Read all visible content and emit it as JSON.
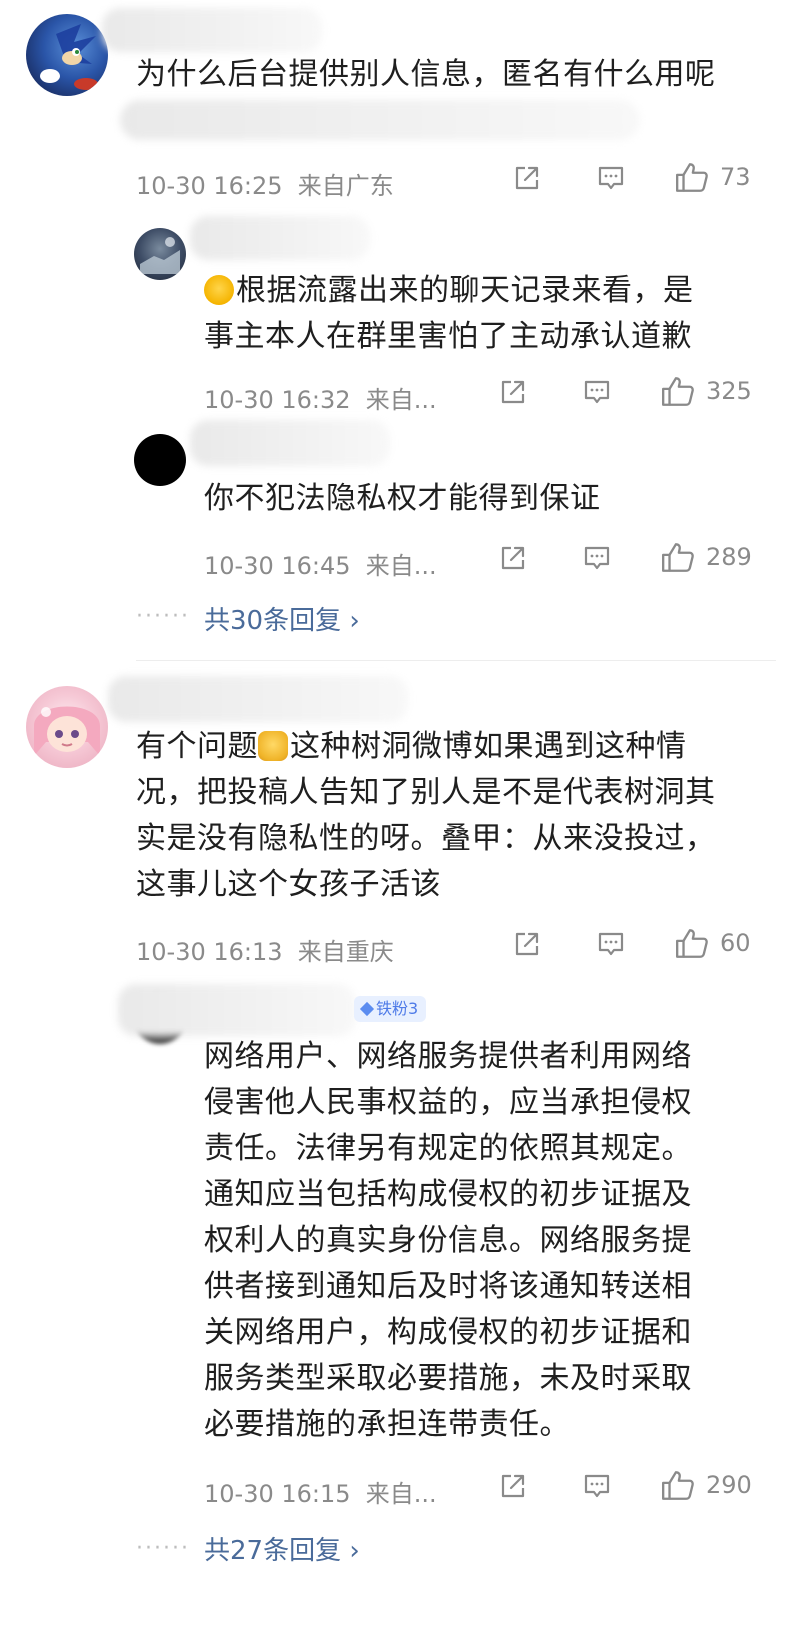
{
  "comments": [
    {
      "text": "为什么后台提供别人信息，匿名有什么用呢",
      "time": "10-30 16:25",
      "location": "来自广东",
      "likes": "73",
      "replies": [
        {
          "text_line1": "根据流露出来的聊天记录来看，是",
          "text_line2": "事主本人在群里害怕了主动承认道歉",
          "time": "10-30 16:32",
          "location": "来自...",
          "likes": "325"
        },
        {
          "text": "你不犯法隐私权才能得到保证",
          "time": "10-30 16:45",
          "location": "来自...",
          "likes": "289"
        }
      ],
      "more_replies": "共30条回复 ›"
    },
    {
      "text_before_emoji": "有个问题",
      "text_line1_rest": "这种树洞微博如果遇到这种情",
      "text_line2": "况，把投稿人告知了别人是不是代表树洞其",
      "text_line3": "实是没有隐私性的呀。叠甲：从来没投过，",
      "text_line4": "这事儿这个女孩子活该",
      "time": "10-30 16:13",
      "location": "来自重庆",
      "likes": "60",
      "replies": [
        {
          "badge": "铁粉3",
          "lines": [
            "网络用户、网络服务提供者利用网络",
            "侵害他人民事权益的，应当承担侵权",
            "责任。法律另有规定的依照其规定。",
            "通知应当包括构成侵权的初步证据及",
            "权利人的真实身份信息。网络服务提",
            "供者接到通知后及时将该通知转送相",
            "关网络用户，构成侵权的初步证据和",
            "服务类型采取必要措施，未及时采取",
            "必要措施的承担连带责任。"
          ],
          "time": "10-30 16:15",
          "location": "来自...",
          "likes": "290"
        }
      ],
      "more_replies": "共27条回复 ›"
    }
  ],
  "icons": {
    "share": "share-icon",
    "comment": "comment-icon",
    "like": "thumbs-up-icon"
  },
  "colors": {
    "link": "#4a6b9a",
    "meta": "#8a8a8a",
    "badge_bg": "#e8f0ff",
    "badge_fg": "#4f7be8"
  }
}
